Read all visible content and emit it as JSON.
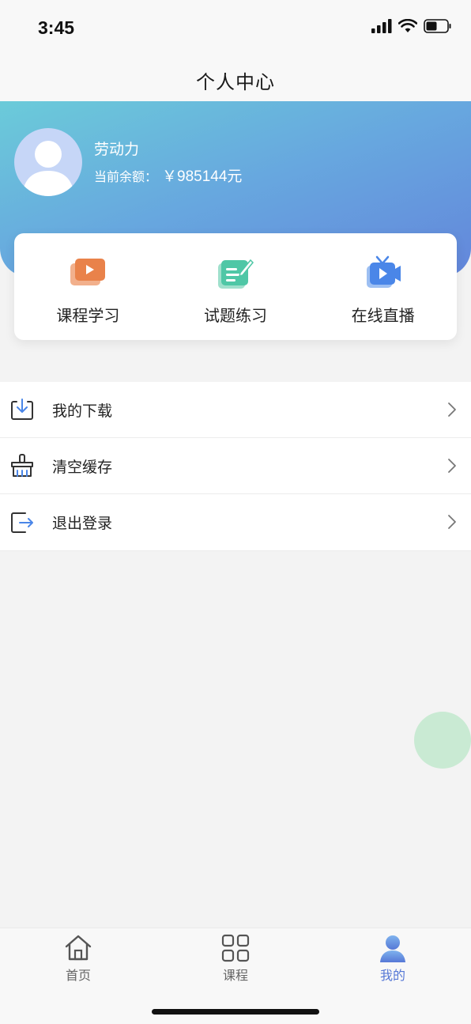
{
  "status_bar": {
    "time": "3:45"
  },
  "nav": {
    "title": "个人中心"
  },
  "profile": {
    "name": "劳动力",
    "balance_label": "当前余额：",
    "balance_value": "￥985144元"
  },
  "quick_actions": [
    {
      "label": "课程学习",
      "icon": "course-video-icon",
      "color": "#e9824a"
    },
    {
      "label": "试题练习",
      "icon": "exercise-edit-icon",
      "color": "#4fc7a6"
    },
    {
      "label": "在线直播",
      "icon": "live-tv-icon",
      "color": "#4a86e8"
    }
  ],
  "menu": [
    {
      "label": "我的下载",
      "icon": "download-icon"
    },
    {
      "label": "清空缓存",
      "icon": "clear-cache-icon"
    },
    {
      "label": "退出登录",
      "icon": "logout-icon"
    }
  ],
  "tabs": [
    {
      "label": "首页",
      "icon": "home-icon",
      "active": false
    },
    {
      "label": "课程",
      "icon": "grid-icon",
      "active": false
    },
    {
      "label": "我的",
      "icon": "user-icon",
      "active": true
    }
  ],
  "colors": {
    "accent": "#5678d6",
    "header_gradient_start": "#6bcbd9",
    "header_gradient_end": "#6386db"
  }
}
